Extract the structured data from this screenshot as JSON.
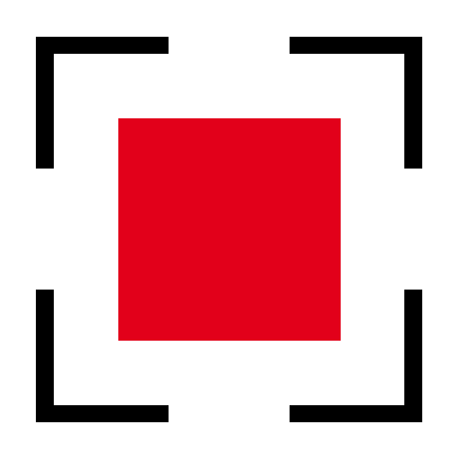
{
  "icon": {
    "name": "focus-frame-stop-icon",
    "corner_color": "#000000",
    "center_color": "#e2001a",
    "background_color": "#ffffff"
  }
}
